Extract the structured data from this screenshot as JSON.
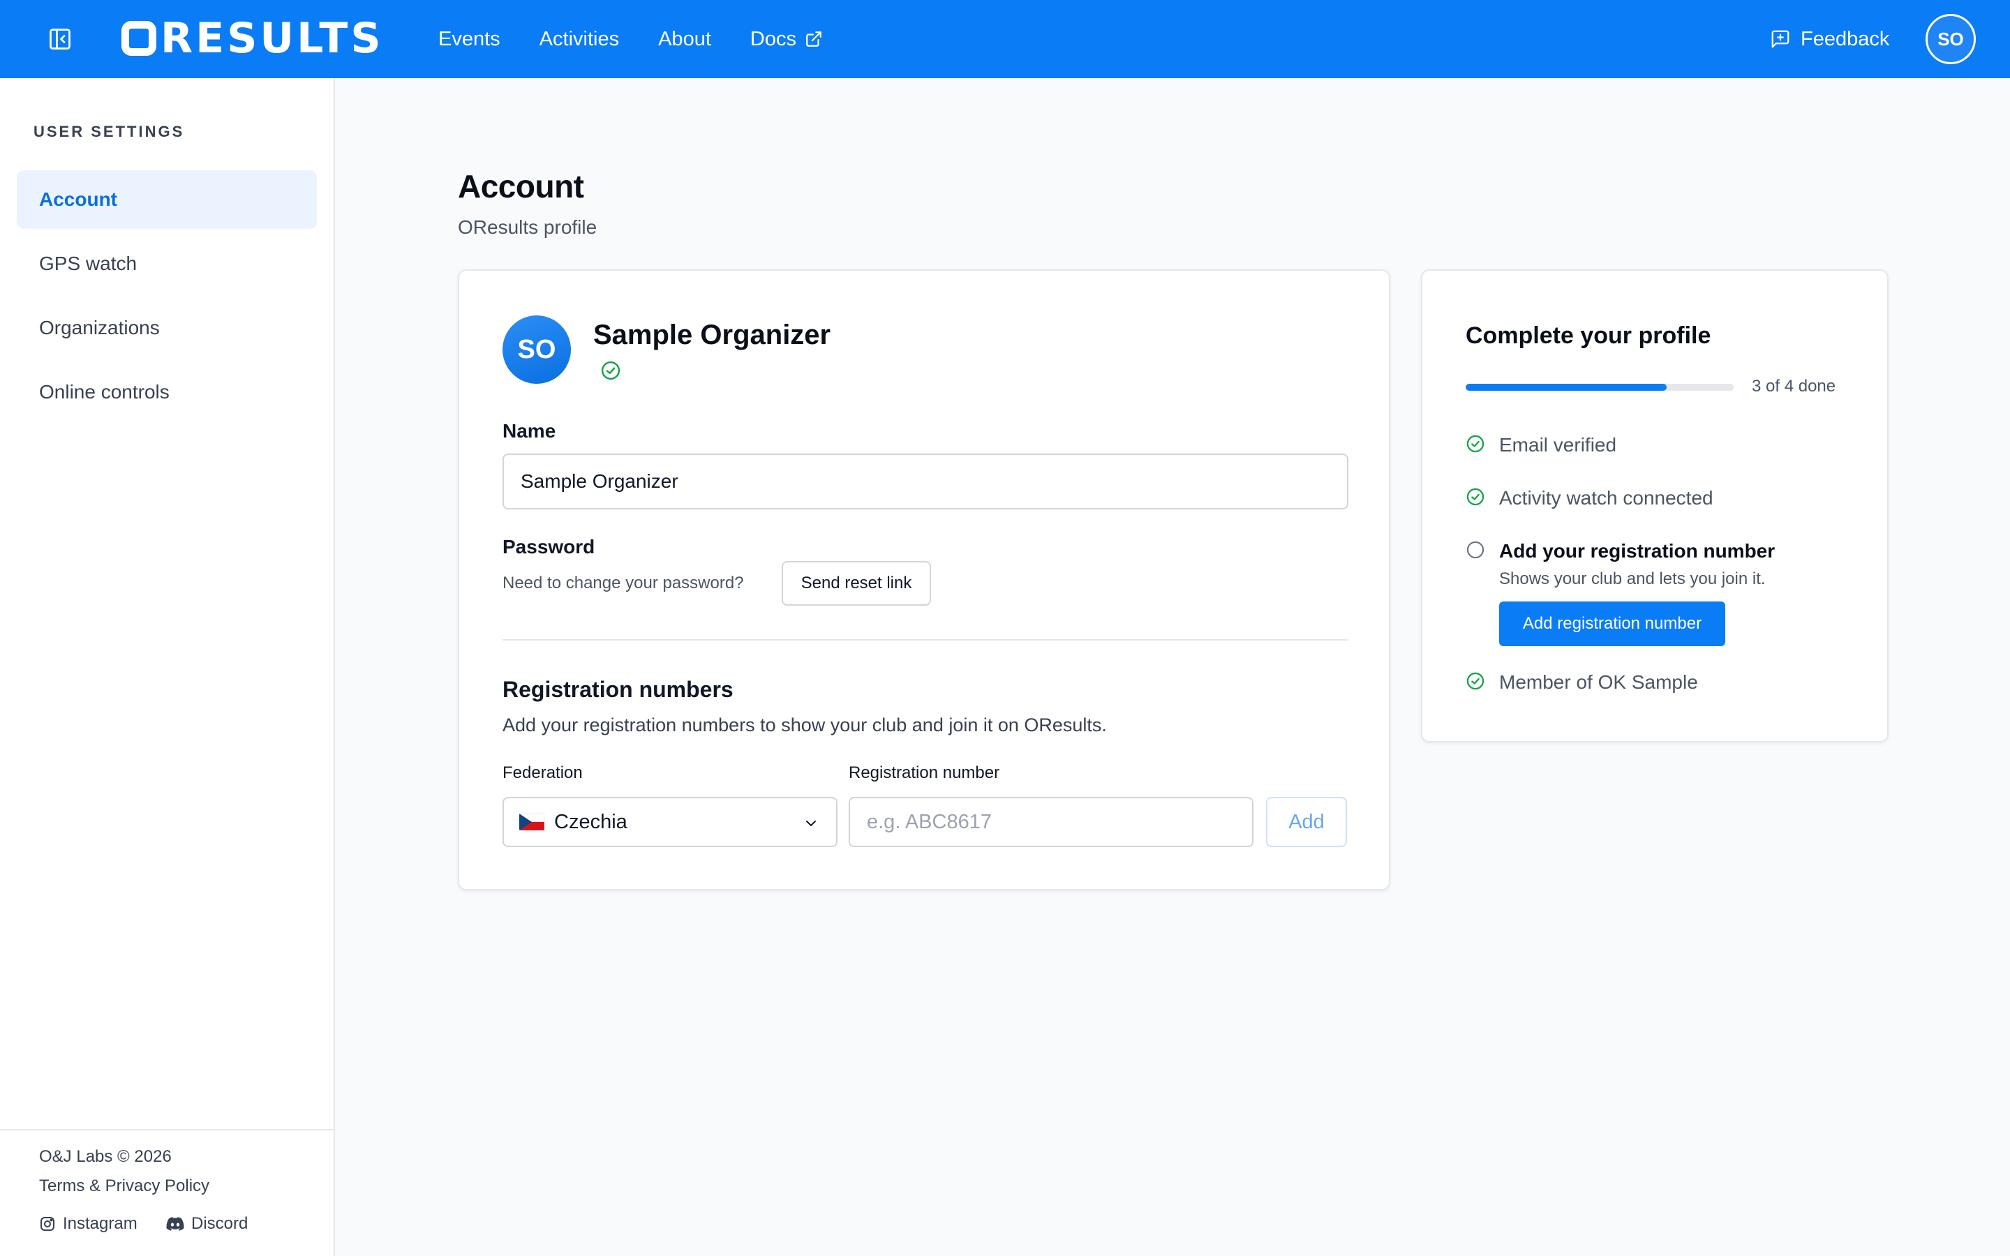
{
  "header": {
    "logo_text": "RESULTS",
    "nav": [
      {
        "label": "Events"
      },
      {
        "label": "Activities"
      },
      {
        "label": "About"
      },
      {
        "label": "Docs"
      }
    ],
    "feedback_label": "Feedback",
    "avatar_initials": "SO"
  },
  "sidebar": {
    "heading": "USER SETTINGS",
    "items": [
      {
        "label": "Account",
        "active": true
      },
      {
        "label": "GPS watch"
      },
      {
        "label": "Organizations"
      },
      {
        "label": "Online controls"
      }
    ],
    "footer": {
      "copyright": "O&J Labs © 2026",
      "terms": "Terms & Privacy Policy",
      "instagram": "Instagram",
      "discord": "Discord"
    }
  },
  "page": {
    "title": "Account",
    "subtitle": "OResults profile"
  },
  "profile": {
    "initials": "SO",
    "name": "Sample Organizer",
    "name_label": "Name",
    "name_value": "Sample Organizer",
    "password_label": "Password",
    "password_hint": "Need to change your password?",
    "reset_button": "Send reset link"
  },
  "registration": {
    "title": "Registration numbers",
    "description": "Add your registration numbers to show your club and join it on OResults.",
    "federation_label": "Federation",
    "federation_value": "Czechia",
    "number_label": "Registration number",
    "number_placeholder": "e.g. ABC8617",
    "add_button": "Add"
  },
  "completion": {
    "title": "Complete your profile",
    "progress_text": "3 of 4 done",
    "progress_fraction": 0.75,
    "items": [
      {
        "label": "Email verified",
        "done": true
      },
      {
        "label": "Activity watch connected",
        "done": true
      },
      {
        "label": "Add your registration number",
        "done": false,
        "sub": "Shows your club and lets you join it.",
        "button": "Add registration number"
      },
      {
        "label": "Member of OK Sample",
        "done": true
      }
    ]
  },
  "colors": {
    "brand": "#0a7cf5",
    "success": "#16a34a"
  }
}
